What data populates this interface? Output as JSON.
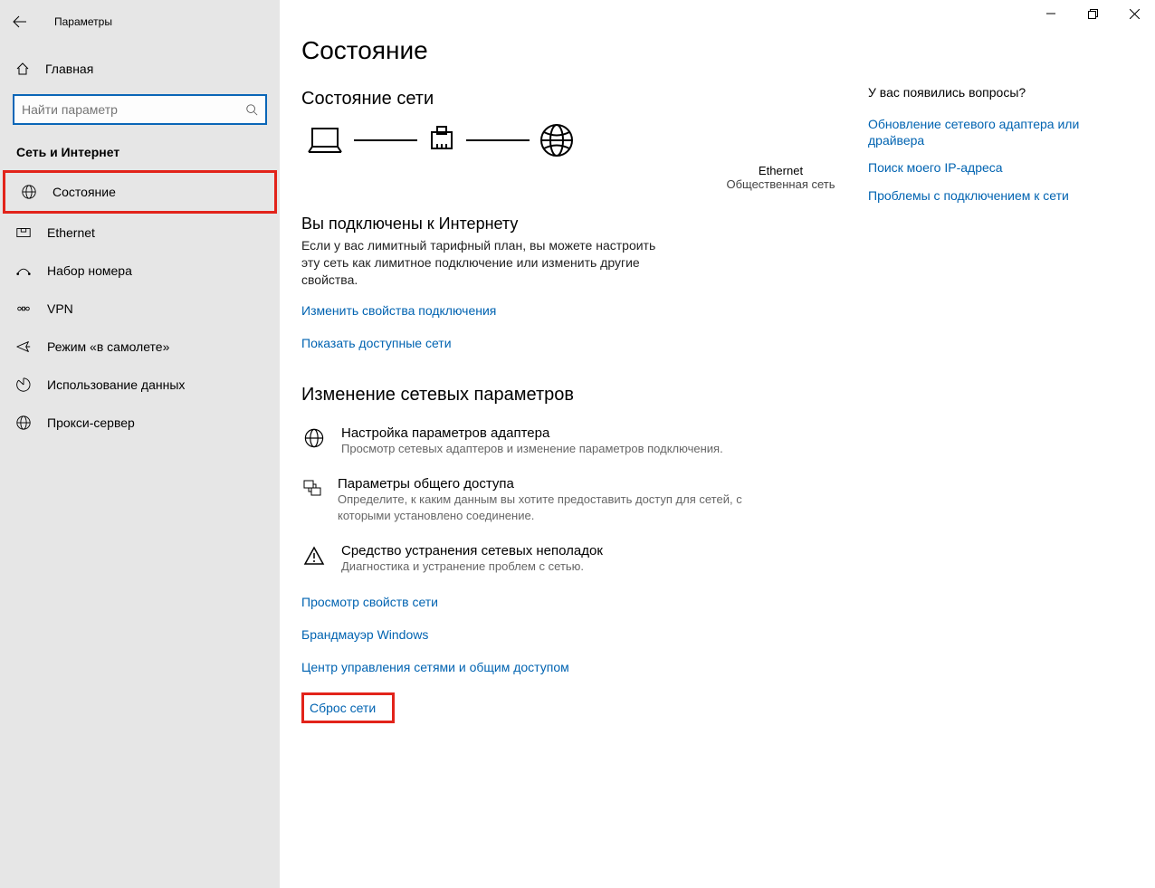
{
  "app_title": "Параметры",
  "sidebar": {
    "home": "Главная",
    "search_placeholder": "Найти параметр",
    "section": "Сеть и Интернет",
    "items": [
      {
        "label": "Состояние"
      },
      {
        "label": "Ethernet"
      },
      {
        "label": "Набор номера"
      },
      {
        "label": "VPN"
      },
      {
        "label": "Режим «в самолете»"
      },
      {
        "label": "Использование данных"
      },
      {
        "label": "Прокси-сервер"
      }
    ]
  },
  "page": {
    "title": "Состояние",
    "network_status_heading": "Состояние сети",
    "diagram": {
      "middle_label": "Ethernet",
      "middle_sub": "Общественная сеть"
    },
    "connected_title": "Вы подключены к Интернету",
    "connected_desc": "Если у вас лимитный тарифный план, вы можете настроить эту сеть как лимитное подключение или изменить другие свойства.",
    "link_change_props": "Изменить свойства подключения",
    "link_show_networks": "Показать доступные сети",
    "change_settings_heading": "Изменение сетевых параметров",
    "settings": [
      {
        "title": "Настройка параметров адаптера",
        "desc": "Просмотр сетевых адаптеров и изменение параметров подключения."
      },
      {
        "title": "Параметры общего доступа",
        "desc": "Определите, к каким данным вы хотите предоставить доступ для сетей, с которыми установлено соединение."
      },
      {
        "title": "Средство устранения сетевых неполадок",
        "desc": "Диагностика и устранение проблем с сетью."
      }
    ],
    "bottom_links": [
      "Просмотр свойств сети",
      "Брандмауэр Windows",
      "Центр управления сетями и общим доступом",
      "Сброс сети"
    ]
  },
  "help": {
    "title": "У вас появились вопросы?",
    "links": [
      "Обновление сетевого адаптера или драйвера",
      "Поиск моего IP-адреса",
      "Проблемы с подключением к сети"
    ]
  }
}
